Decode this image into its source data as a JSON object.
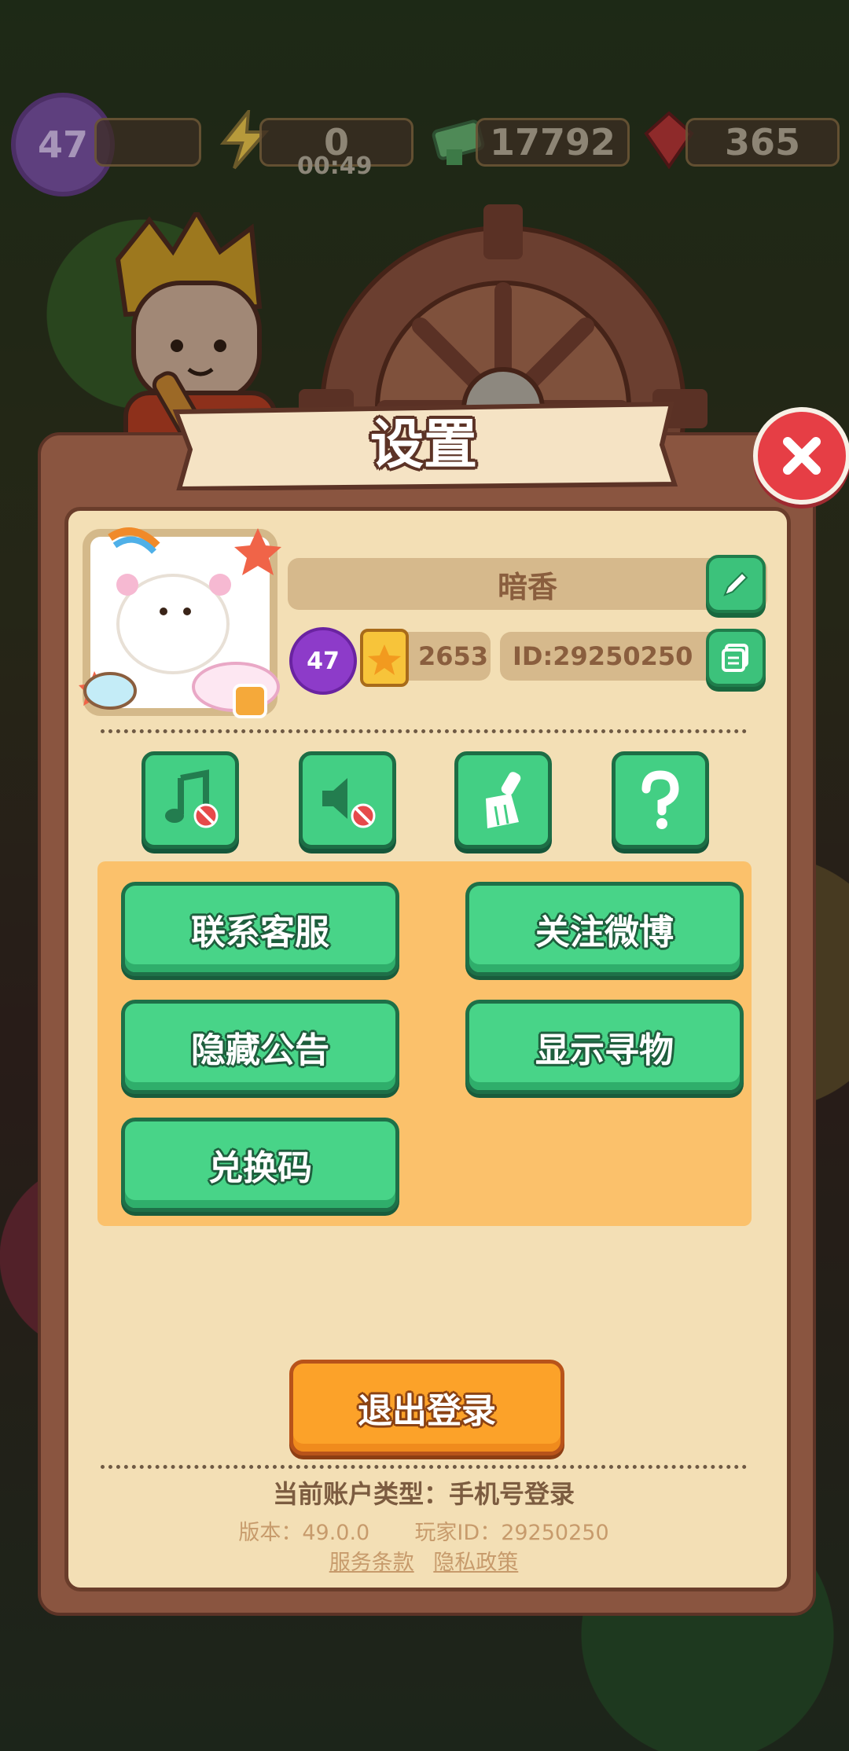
{
  "hud": {
    "level": "47",
    "energy_value": "0",
    "energy_timer": "00:49",
    "cash_value": "17792",
    "gems_value": "365"
  },
  "dialog": {
    "title": "设置"
  },
  "profile": {
    "name": "暗香",
    "level": "47",
    "points": "2653",
    "id_text": "ID:29250250"
  },
  "toggles": [
    {
      "icon": "music-off-icon"
    },
    {
      "icon": "sound-off-icon"
    },
    {
      "icon": "broom-icon"
    },
    {
      "icon": "help-icon"
    }
  ],
  "buttons": {
    "contact": "联系客服",
    "weibo": "关注微博",
    "hide_notice": "隐藏公告",
    "show_find": "显示寻物",
    "redeem": "兑换码",
    "logout": "退出登录"
  },
  "footer": {
    "account_type": "当前账户类型：手机号登录",
    "version": "版本：49.0.0",
    "player_id": "玩家ID：29250250",
    "terms": "服务条款",
    "privacy": "隐私政策"
  },
  "colors": {
    "green_button": "#48d488",
    "orange_button": "#fca229",
    "panel_bg": "#f3dfb5",
    "close_red": "#e63e45"
  }
}
